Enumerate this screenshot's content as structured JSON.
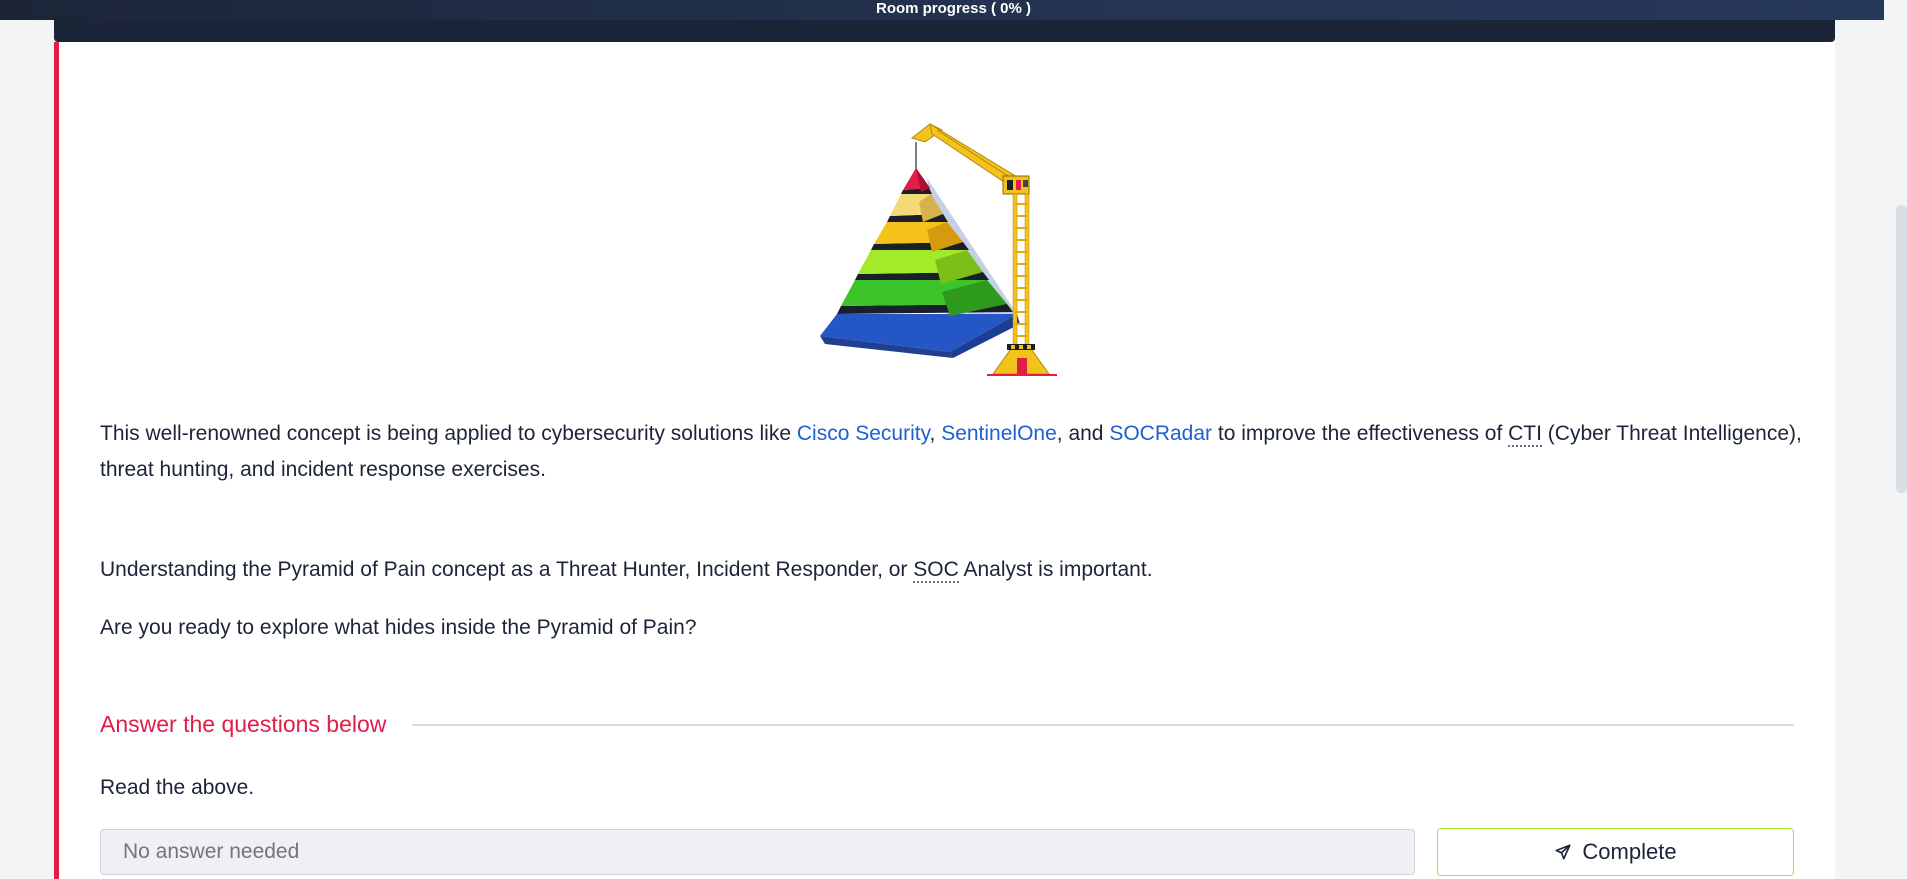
{
  "progress": {
    "label": "Room progress ( 0% )",
    "value": 0
  },
  "intro": {
    "p1_pre": "This well-renowned concept is being applied to cybersecurity solutions like ",
    "link1": "Cisco Security",
    "sep1": ", ",
    "link2": "SentinelOne",
    "sep2": ", and ",
    "link3": "SOCRadar",
    "p1_mid": " to improve the effectiveness of ",
    "abbr_cti": "CTI",
    "p1_post": " (Cyber Threat Intelligence), threat hunting, and incident response exercises.",
    "p2_pre": "Understanding the Pyramid of Pain concept as a Threat Hunter, Incident Responder, or ",
    "abbr_soc": "SOC",
    "p2_post": " Analyst is important.",
    "p3": "Are you ready to explore what hides inside the Pyramid of Pain?"
  },
  "questions": {
    "title": "Answer the questions below",
    "q1": {
      "text": "Read the above.",
      "placeholder": "No answer needed",
      "button": "Complete"
    }
  },
  "colors": {
    "accent": "#e11d48",
    "link": "#1f5fd6",
    "button_border": "#a3ea2a",
    "header": "#1c2538"
  },
  "icons": [
    "send-icon",
    "pyramid-crane-illustration"
  ]
}
